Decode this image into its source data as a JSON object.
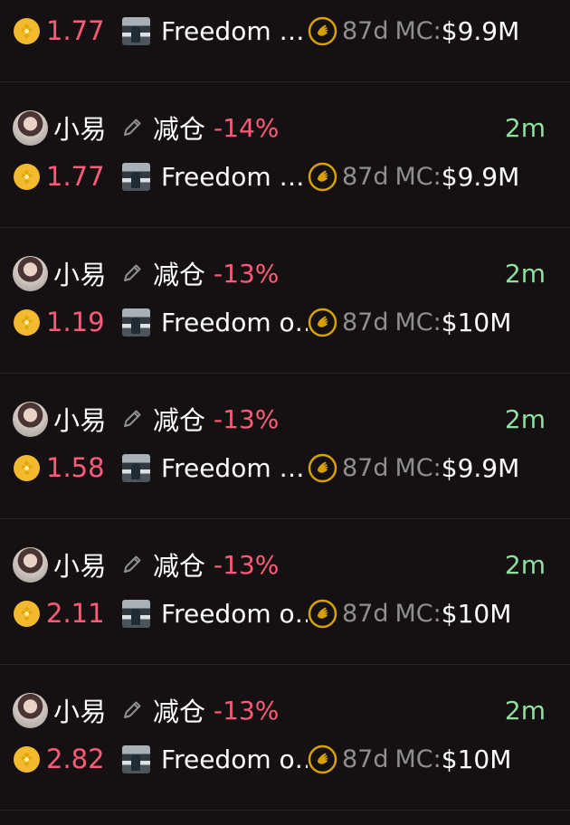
{
  "items": [
    {
      "user": "",
      "action": "",
      "percent": "",
      "time": "",
      "amount": "1.77",
      "token": "Freedom …",
      "age": "87d",
      "mc_label": "MC:",
      "mc_value": "$9.9M",
      "show_user": false
    },
    {
      "user": "小易",
      "action": "减仓",
      "percent": "-14%",
      "time": "2m",
      "amount": "1.77",
      "token": "Freedom …",
      "age": "87d",
      "mc_label": "MC:",
      "mc_value": "$9.9M",
      "show_user": true
    },
    {
      "user": "小易",
      "action": "减仓",
      "percent": "-13%",
      "time": "2m",
      "amount": "1.19",
      "token": "Freedom o…",
      "age": "87d",
      "mc_label": "MC:",
      "mc_value": "$10M",
      "show_user": true
    },
    {
      "user": "小易",
      "action": "减仓",
      "percent": "-13%",
      "time": "2m",
      "amount": "1.58",
      "token": "Freedom …",
      "age": "87d",
      "mc_label": "MC:",
      "mc_value": "$9.9M",
      "show_user": true
    },
    {
      "user": "小易",
      "action": "减仓",
      "percent": "-13%",
      "time": "2m",
      "amount": "2.11",
      "token": "Freedom o…",
      "age": "87d",
      "mc_label": "MC:",
      "mc_value": "$10M",
      "show_user": true
    },
    {
      "user": "小易",
      "action": "减仓",
      "percent": "-13%",
      "time": "2m",
      "amount": "2.82",
      "token": "Freedom o…",
      "age": "87d",
      "mc_label": "MC:",
      "mc_value": "$10M",
      "show_user": true
    }
  ],
  "icons": {
    "coin": "bnb-icon",
    "edit": "pencil-icon",
    "wave": "waving-hand-icon",
    "avatar": "user-avatar",
    "token": "token-avatar"
  },
  "colors": {
    "background": "#151113",
    "text": "#ffffff",
    "negative": "#ff5b78",
    "time": "#8fe19b",
    "muted": "#8f8f8f",
    "coin": "#f3ba2f",
    "wave_ring": "#d7a200"
  }
}
